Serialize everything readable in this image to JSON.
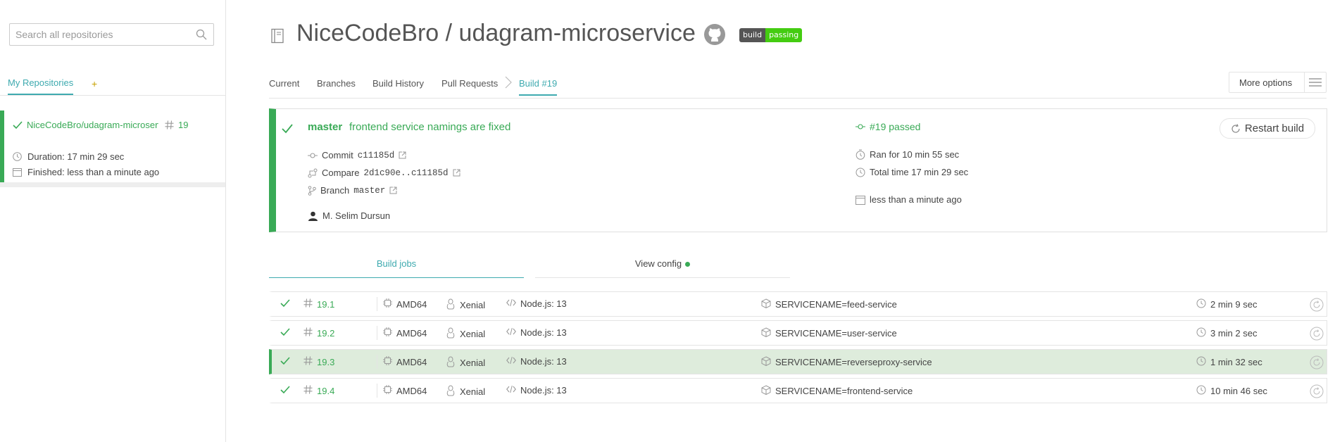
{
  "sidebar": {
    "search_placeholder": "Search all repositories",
    "tab_my_repos": "My Repositories",
    "add_label": "+",
    "repo": {
      "name": "NiceCodeBro/udagram-microservice",
      "build_number": "19",
      "duration": "Duration: 17 min 29 sec",
      "finished": "Finished: less than a minute ago"
    }
  },
  "header": {
    "title": "NiceCodeBro / udagram-microservice",
    "badge_left": "build",
    "badge_right": "passing"
  },
  "tabs": [
    {
      "label": "Current"
    },
    {
      "label": "Branches"
    },
    {
      "label": "Build History"
    },
    {
      "label": "Pull Requests"
    },
    {
      "label": "Build #19"
    }
  ],
  "more_options_label": "More options",
  "build": {
    "branch": "master",
    "message": "frontend service namings are fixed",
    "commit_label": "Commit",
    "commit": "c11185d",
    "compare_label": "Compare",
    "compare": "2d1c90e..c11185d",
    "branch_label": "Branch",
    "branch_name": "master",
    "author": "M. Selim Dursun",
    "status": "#19 passed",
    "ran_for": "Ran for 10 min 55 sec",
    "total_time": "Total time 17 min 29 sec",
    "finished": "less than a minute ago",
    "restart_label": "Restart build"
  },
  "jobs_tabs": {
    "build_jobs": "Build jobs",
    "view_config": "View config"
  },
  "jobs": [
    {
      "number": "19.1",
      "arch": "AMD64",
      "os": "Xenial",
      "lang": "Node.js: 13",
      "env": "SERVICENAME=feed-service",
      "duration": "2 min 9 sec"
    },
    {
      "number": "19.2",
      "arch": "AMD64",
      "os": "Xenial",
      "lang": "Node.js: 13",
      "env": "SERVICENAME=user-service",
      "duration": "3 min 2 sec"
    },
    {
      "number": "19.3",
      "arch": "AMD64",
      "os": "Xenial",
      "lang": "Node.js: 13",
      "env": "SERVICENAME=reverseproxy-service",
      "duration": "1 min 32 sec"
    },
    {
      "number": "19.4",
      "arch": "AMD64",
      "os": "Xenial",
      "lang": "Node.js: 13",
      "env": "SERVICENAME=frontend-service",
      "duration": "10 min 46 sec"
    }
  ],
  "colors": {
    "accent": "#3eaaaf",
    "passed": "#39aa56",
    "selected_row": "#deecdc"
  }
}
